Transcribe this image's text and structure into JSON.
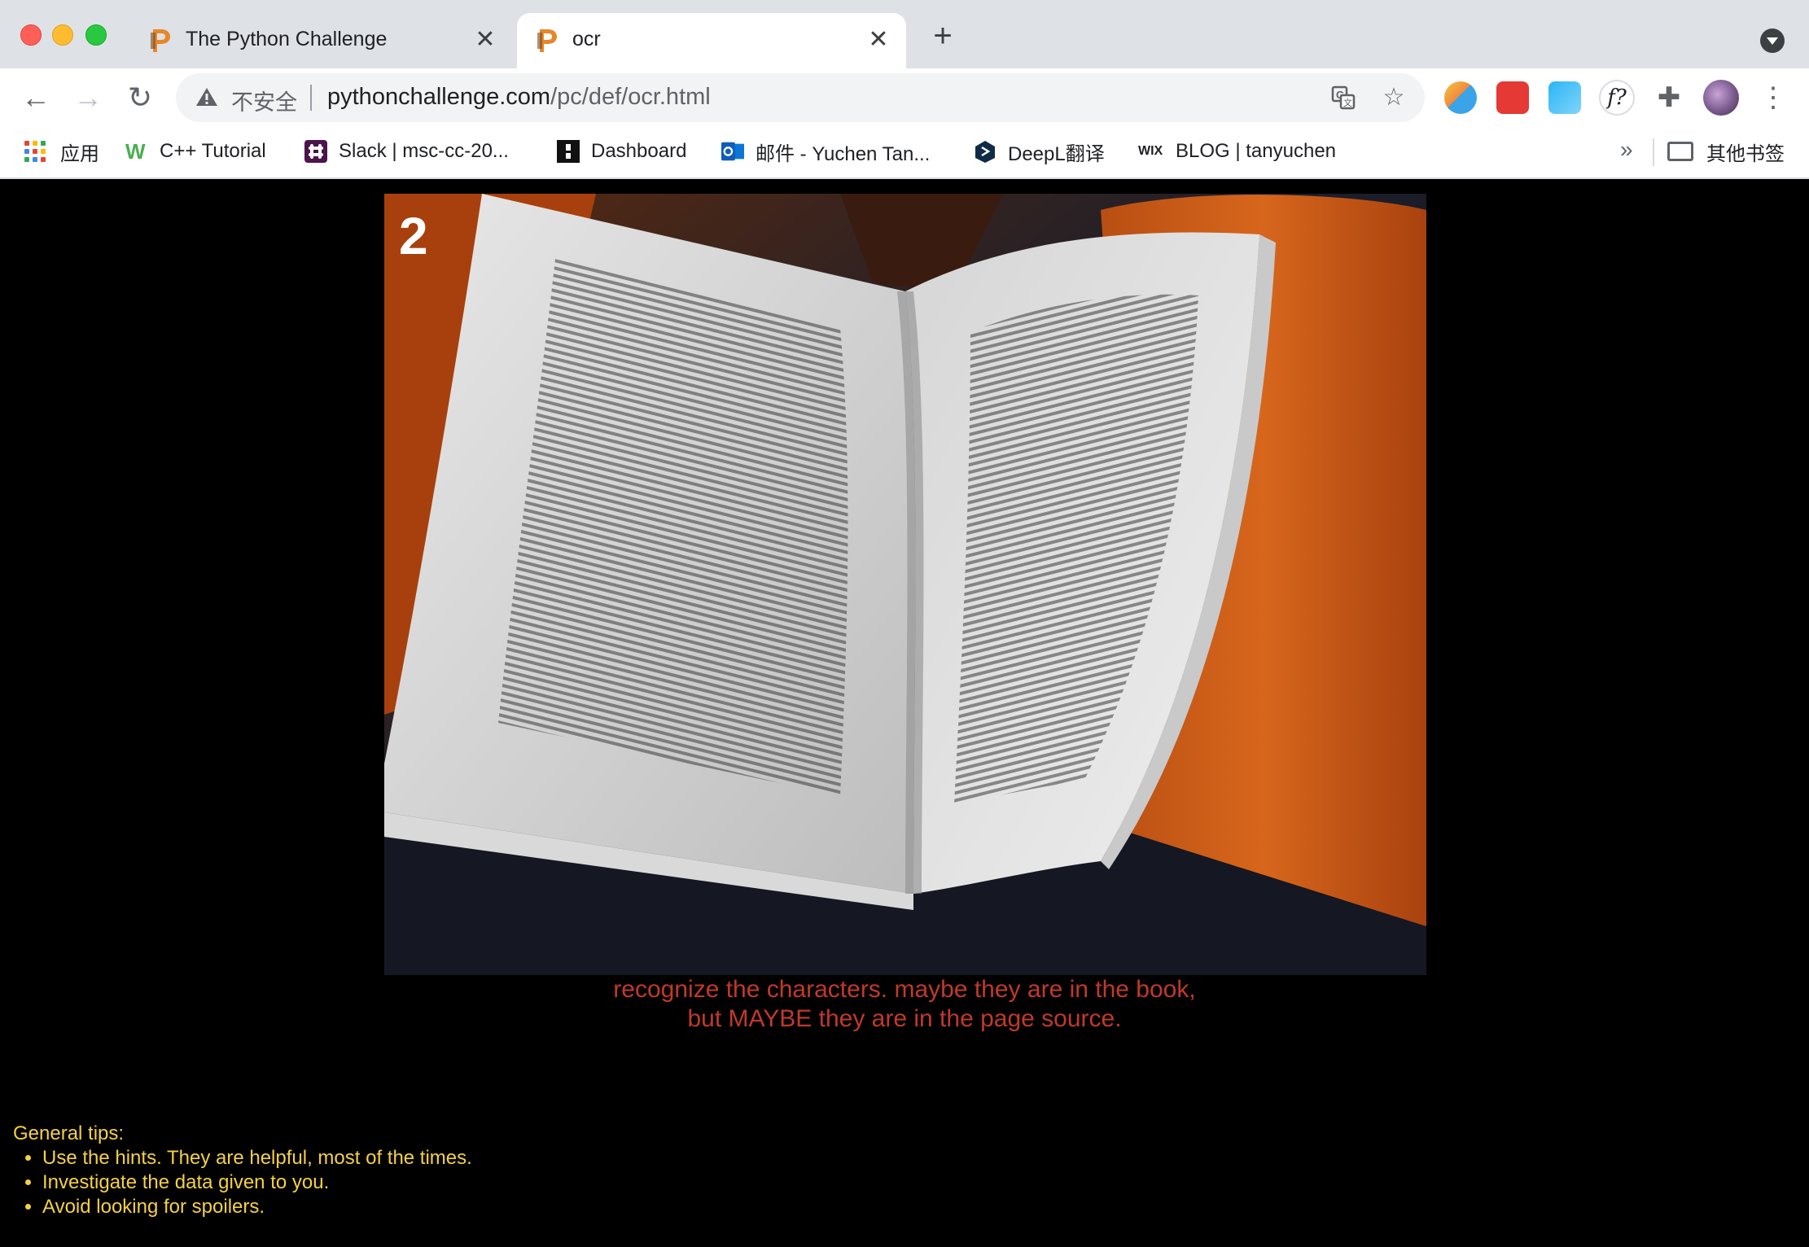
{
  "window": {
    "tabs": [
      {
        "title": "The Python Challenge",
        "active": false
      },
      {
        "title": "ocr",
        "active": true
      }
    ]
  },
  "toolbar": {
    "security_label": "不安全",
    "url_host": "pythonchallenge.com",
    "url_path": "/pc/def/ocr.html"
  },
  "bookmarks": {
    "items": [
      {
        "label": "应用",
        "icon": "apps-grid-icon"
      },
      {
        "label": "C++ Tutorial",
        "icon": "w3schools-icon"
      },
      {
        "label": "Slack | msc-cc-20...",
        "icon": "slack-icon"
      },
      {
        "label": "Dashboard",
        "icon": "dashboard-icon"
      },
      {
        "label": "邮件 - Yuchen Tan...",
        "icon": "outlook-icon"
      },
      {
        "label": "DeepL翻译",
        "icon": "deepl-icon"
      },
      {
        "label": "BLOG | tanyuchen",
        "icon": "wix-icon"
      }
    ],
    "overflow": "»",
    "other_label": "其他书签"
  },
  "page": {
    "image_number": "2",
    "caption_line1": "recognize the characters. maybe they are in the book,",
    "caption_line2": "but MAYBE they are in the page source.",
    "tips_title": "General tips:",
    "tips": [
      "Use the hints. They are helpful, most of the times.",
      "Investigate the data given to you.",
      "Avoid looking for spoilers."
    ]
  },
  "colors": {
    "page_background": "#000000",
    "caption": "#c0392b",
    "tips": "#f5d142"
  }
}
